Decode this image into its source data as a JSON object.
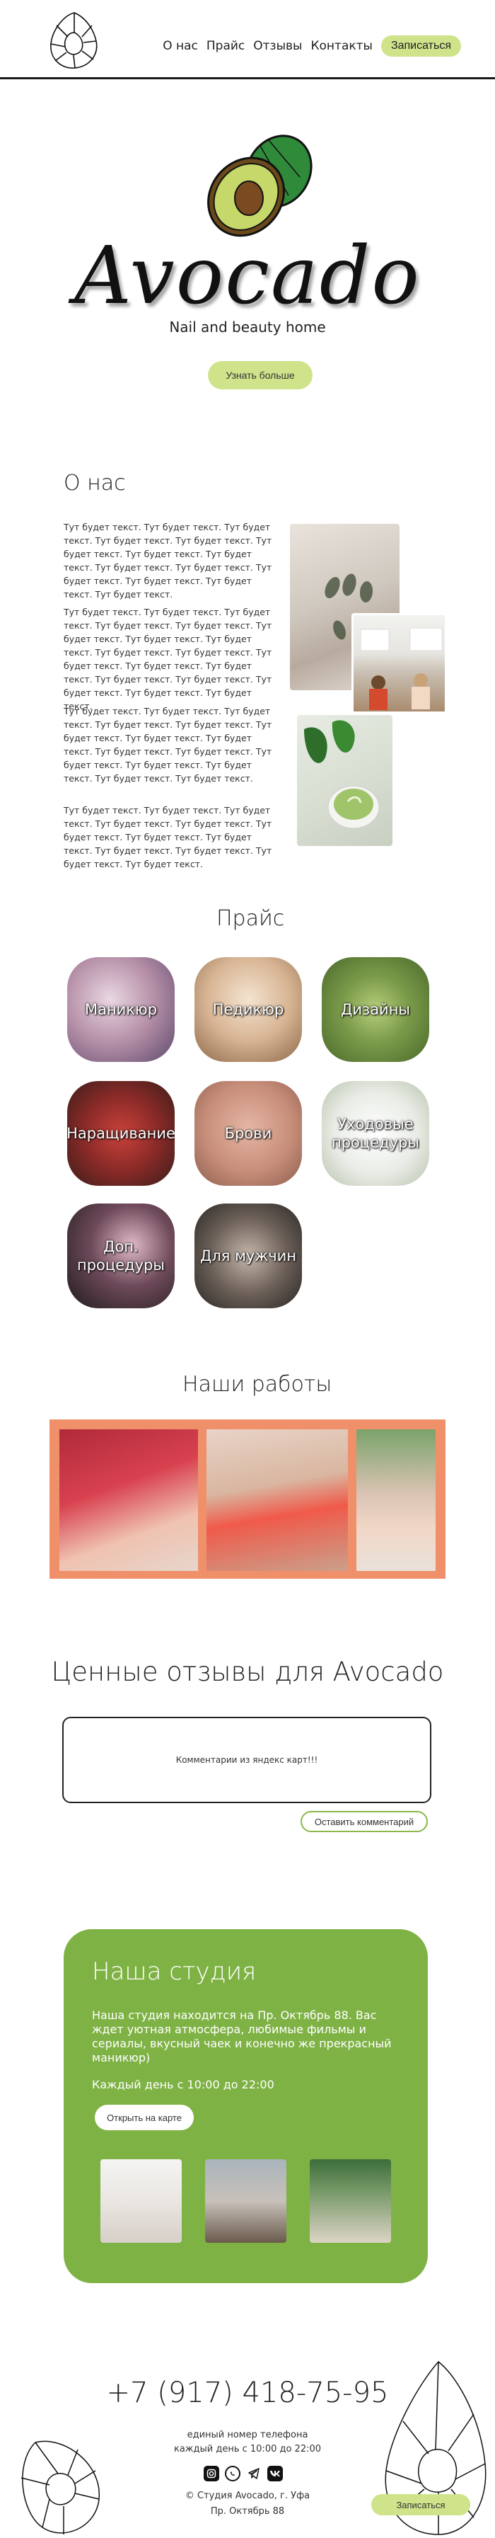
{
  "nav": {
    "items": [
      "О нас",
      "Прайс",
      "Отзывы",
      "Контакты"
    ],
    "cta": "Записаться"
  },
  "hero": {
    "brand": "Avocado",
    "tagline": "Nail and beauty home",
    "button": "Узнать больше"
  },
  "about": {
    "title": "О нас",
    "paragraphs": [
      "Тут будет текст. Тут будет текст. Тут будет текст. Тут будет текст. Тут будет текст. Тут будет текст. Тут будет текст. Тут будет текст. Тут будет текст. Тут будет текст. Тут будет текст. Тут будет текст. Тут будет текст. Тут будет текст.",
      "Тут будет текст. Тут будет текст. Тут будет текст. Тут будет текст. Тут будет текст. Тут будет текст. Тут будет текст. Тут будет текст. Тут будет текст. Тут будет текст. Тут будет текст. Тут будет текст. Тут будет текст. Тут будет текст. Тут будет текст. Тут будет текст. Тут будет текст. Тут будет текст.",
      "Тут будет текст. Тут будет текст. Тут будет текст. Тут будет текст. Тут будет текст. Тут будет текст. Тут будет текст. Тут будет текст. Тут будет текст. Тут будет текст. Тут будет текст. Тут будет текст. Тут будет текст. Тут будет текст. Тут будет текст.",
      "Тут будет текст. Тут будет текст. Тут будет текст. Тут будет текст. Тут будет текст. Тут будет текст. Тут будет текст. Тут будет текст. Тут будет текст. Тут будет текст. Тут будет текст. Тут будет текст."
    ]
  },
  "price": {
    "title": "Прайс",
    "tiles": [
      "Маникюр",
      "Педикюр",
      "Дизайны",
      "Наращивание",
      "Брови",
      "Уходовые процедуры",
      "Доп. процедуры",
      "Для мужчин"
    ]
  },
  "works": {
    "title": "Наши работы"
  },
  "reviews": {
    "title": "Ценные отзывы для Avocado",
    "box_text": "Комментарии из яндекс карт!!!",
    "button": "Оставить комментарий"
  },
  "studio": {
    "title": "Наша студия",
    "description": "Наша студия находится на Пр. Октябрь 88. Вас ждет уютная атмосфера, любимые фильмы и сериалы, вкусный чаек и конечно же прекрасный маникюр)",
    "hours": "Каждый день с 10:00 до 22:00",
    "map_button": "Открыть на карте"
  },
  "footer": {
    "phone": "+7 (917) 418-75-95",
    "phone_note": "единый номер телефона",
    "hours": "каждый день с 10:00 до 22:00",
    "copyright": "© Студия Avocado, г. Уфа",
    "address": "Пр. Октябрь 88",
    "cta": "Записаться",
    "social_icons": [
      "instagram-icon",
      "whatsapp-icon",
      "telegram-icon",
      "vk-icon"
    ]
  },
  "colors": {
    "accent_green": "#cfe38a",
    "studio_green": "#7fb245",
    "works_band": "#f0906b"
  }
}
